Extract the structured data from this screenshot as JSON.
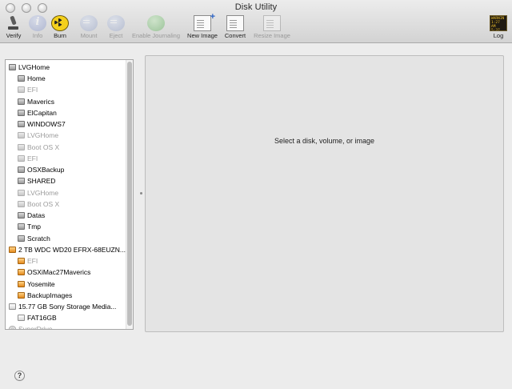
{
  "window": {
    "title": "Disk Utility"
  },
  "toolbar": [
    {
      "name": "verify",
      "label": "Verify",
      "enabled": true
    },
    {
      "name": "info",
      "label": "Info",
      "enabled": false
    },
    {
      "name": "burn",
      "label": "Burn",
      "enabled": true
    },
    {
      "name": "mount",
      "label": "Mount",
      "enabled": false
    },
    {
      "name": "eject",
      "label": "Eject",
      "enabled": false
    },
    {
      "name": "enable-journaling",
      "label": "Enable Journaling",
      "enabled": false
    },
    {
      "name": "new-image",
      "label": "New Image",
      "enabled": true
    },
    {
      "name": "convert",
      "label": "Convert",
      "enabled": true
    },
    {
      "name": "resize-image",
      "label": "Resize Image",
      "enabled": false
    },
    {
      "name": "log",
      "label": "Log",
      "enabled": true,
      "icon_text": "WARNIN 1:27 AM 5:37 PM"
    }
  ],
  "sidebar": {
    "items": [
      {
        "label": "LVGHome",
        "level": 0,
        "icon": "gray-disk-icon",
        "dimmed": false
      },
      {
        "label": "Home",
        "level": 1,
        "icon": "gray-volume-icon",
        "dimmed": false
      },
      {
        "label": "EFI",
        "level": 1,
        "icon": "gray-volume-icon",
        "dimmed": true
      },
      {
        "label": "Maverics",
        "level": 1,
        "icon": "gray-volume-icon",
        "dimmed": false
      },
      {
        "label": "ElCapitan",
        "level": 1,
        "icon": "gray-volume-icon",
        "dimmed": false
      },
      {
        "label": "WINDOWS7",
        "level": 1,
        "icon": "gray-volume-icon",
        "dimmed": false
      },
      {
        "label": "LVGHome",
        "level": 1,
        "icon": "gray-volume-icon",
        "dimmed": true
      },
      {
        "label": "Boot OS X",
        "level": 1,
        "icon": "gray-volume-icon",
        "dimmed": true
      },
      {
        "label": "EFI",
        "level": 1,
        "icon": "gray-volume-icon",
        "dimmed": true
      },
      {
        "label": "OSXBackup",
        "level": 1,
        "icon": "gray-volume-icon",
        "dimmed": false
      },
      {
        "label": "SHARED",
        "level": 1,
        "icon": "gray-volume-icon",
        "dimmed": false
      },
      {
        "label": "LVGHome",
        "level": 1,
        "icon": "gray-volume-icon",
        "dimmed": true
      },
      {
        "label": "Boot OS X",
        "level": 1,
        "icon": "gray-volume-icon",
        "dimmed": true
      },
      {
        "label": "Datas",
        "level": 1,
        "icon": "gray-volume-icon",
        "dimmed": false
      },
      {
        "label": "Tmp",
        "level": 1,
        "icon": "gray-volume-icon",
        "dimmed": false
      },
      {
        "label": "Scratch",
        "level": 1,
        "icon": "gray-volume-icon",
        "dimmed": false
      },
      {
        "label": "2 TB WDC WD20 EFRX-68EUZN...",
        "level": 0,
        "icon": "orange-disk-icon",
        "dimmed": false
      },
      {
        "label": "EFI",
        "level": 1,
        "icon": "orange-volume-icon",
        "dimmed": true
      },
      {
        "label": "OSXiMac27Maverics",
        "level": 1,
        "icon": "orange-volume-icon",
        "dimmed": false
      },
      {
        "label": "Yosemite",
        "level": 1,
        "icon": "orange-volume-icon",
        "dimmed": false
      },
      {
        "label": "BackupImages",
        "level": 1,
        "icon": "orange-volume-icon",
        "dimmed": false
      },
      {
        "label": "15.77 GB Sony Storage Media...",
        "level": 0,
        "icon": "white-disk-icon",
        "dimmed": false
      },
      {
        "label": "FAT16GB",
        "level": 1,
        "icon": "white-volume-icon",
        "dimmed": false
      },
      {
        "label": "SuperDrive",
        "level": 0,
        "icon": "optical-drive-icon",
        "dimmed": true
      }
    ]
  },
  "detail": {
    "placeholder": "Select a disk, volume, or image"
  },
  "help": {
    "label": "?"
  }
}
